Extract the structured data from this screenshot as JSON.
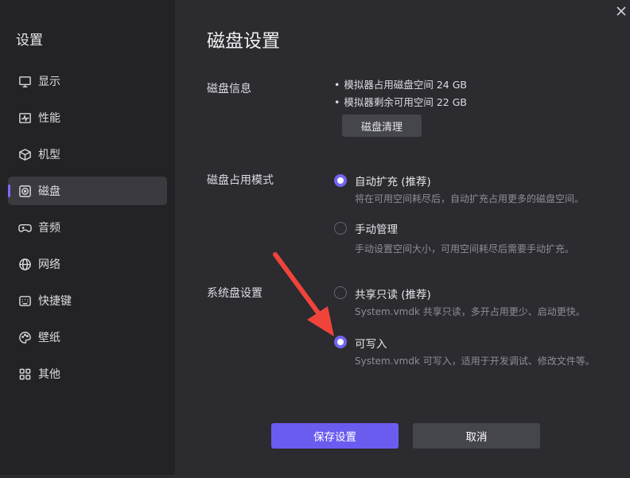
{
  "sidebar": {
    "title": "设置",
    "items": [
      {
        "label": "显示",
        "icon": "monitor-icon",
        "active": false
      },
      {
        "label": "性能",
        "icon": "pulse-icon",
        "active": false
      },
      {
        "label": "机型",
        "icon": "cube-icon",
        "active": false
      },
      {
        "label": "磁盘",
        "icon": "disk-icon",
        "active": true
      },
      {
        "label": "音频",
        "icon": "gamepad-icon",
        "active": false
      },
      {
        "label": "网络",
        "icon": "globe-icon",
        "active": false
      },
      {
        "label": "快捷键",
        "icon": "keyboard-icon",
        "active": false
      },
      {
        "label": "壁纸",
        "icon": "palette-icon",
        "active": false
      },
      {
        "label": "其他",
        "icon": "grid-icon",
        "active": false
      }
    ]
  },
  "main": {
    "title": "磁盘设置",
    "disk_info": {
      "label": "磁盘信息",
      "used": "模拟器占用磁盘空间 24 GB",
      "free": "模拟器剩余可用空间 22 GB",
      "clean_button": "磁盘清理"
    },
    "usage_mode": {
      "label": "磁盘占用模式",
      "options": [
        {
          "label": "自动扩充 (推荐)",
          "desc": "将在可用空间耗尽后，自动扩充占用更多的磁盘空间。",
          "selected": true
        },
        {
          "label": "手动管理",
          "desc": "手动设置空间大小，可用空间耗尽后需要手动扩充。",
          "selected": false
        }
      ]
    },
    "system_disk": {
      "label": "系统盘设置",
      "options": [
        {
          "label": "共享只读 (推荐)",
          "desc": "System.vmdk 共享只读，多开占用更少、启动更快。",
          "selected": false
        },
        {
          "label": "可写入",
          "desc": "System.vmdk 可写入，适用于开发调试、修改文件等。",
          "selected": true
        }
      ]
    },
    "save_button": "保存设置",
    "cancel_button": "取消"
  },
  "colors": {
    "accent": "#6b5cf0",
    "annotation_arrow": "#f0443a"
  }
}
